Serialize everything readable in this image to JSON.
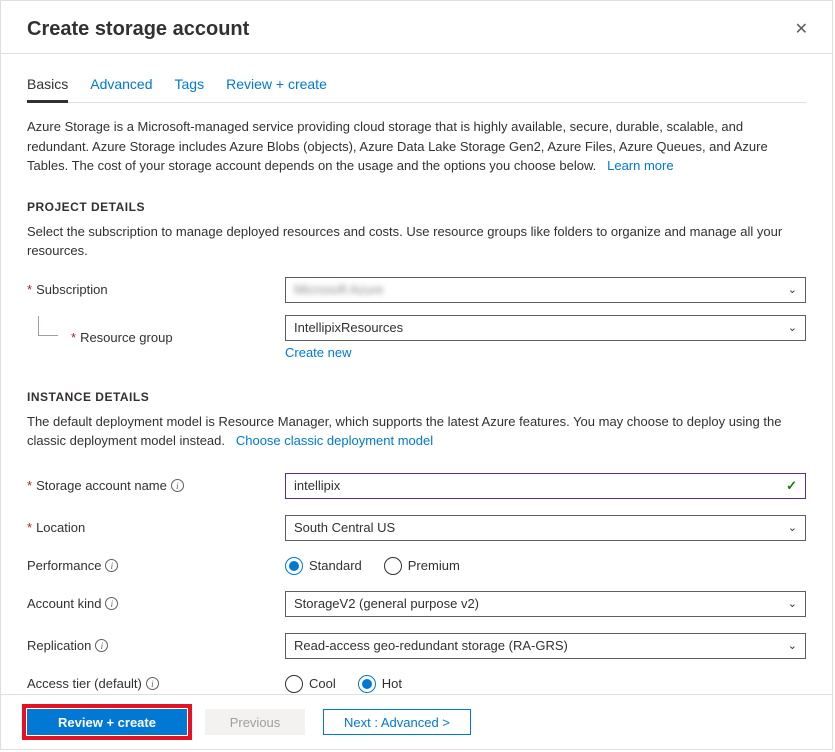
{
  "header": {
    "title": "Create storage account"
  },
  "tabs": {
    "basics": "Basics",
    "advanced": "Advanced",
    "tags": "Tags",
    "review": "Review + create"
  },
  "intro": {
    "text": "Azure Storage is a Microsoft-managed service providing cloud storage that is highly available, secure, durable, scalable, and redundant. Azure Storage includes Azure Blobs (objects), Azure Data Lake Storage Gen2, Azure Files, Azure Queues, and Azure Tables. The cost of your storage account depends on the usage and the options you choose below.",
    "learn_more": "Learn more"
  },
  "project": {
    "title": "PROJECT DETAILS",
    "desc": "Select the subscription to manage deployed resources and costs. Use resource groups like folders to organize and manage all your resources.",
    "subscription_label": "Subscription",
    "subscription_value": "Microsoft Azure",
    "resource_group_label": "Resource group",
    "resource_group_value": "IntellipixResources",
    "create_new": "Create new"
  },
  "instance": {
    "title": "INSTANCE DETAILS",
    "desc": "The default deployment model is Resource Manager, which supports the latest Azure features. You may choose to deploy using the classic deployment model instead.",
    "choose_classic": "Choose classic deployment model",
    "name_label": "Storage account name",
    "name_value": "intellipix",
    "location_label": "Location",
    "location_value": "South Central US",
    "performance_label": "Performance",
    "perf_standard": "Standard",
    "perf_premium": "Premium",
    "kind_label": "Account kind",
    "kind_value": "StorageV2 (general purpose v2)",
    "replication_label": "Replication",
    "replication_value": "Read-access geo-redundant storage (RA-GRS)",
    "tier_label": "Access tier (default)",
    "tier_cool": "Cool",
    "tier_hot": "Hot"
  },
  "footer": {
    "review": "Review + create",
    "previous": "Previous",
    "next": "Next : Advanced >"
  }
}
